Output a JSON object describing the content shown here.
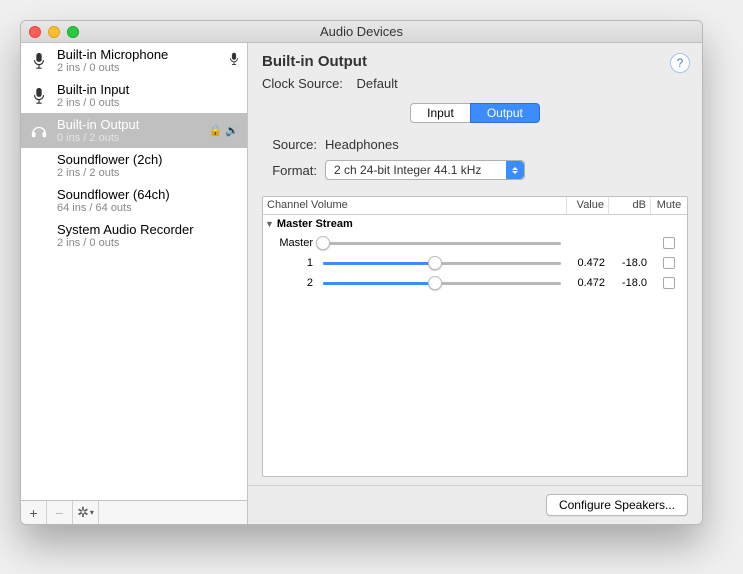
{
  "window": {
    "title": "Audio Devices"
  },
  "sidebar": {
    "devices": [
      {
        "name": "Built-in Microphone",
        "sub": "2 ins / 0 outs",
        "icon": "mic",
        "default_in": true
      },
      {
        "name": "Built-in Input",
        "sub": "2 ins / 0 outs",
        "icon": "mic"
      },
      {
        "name": "Built-in Output",
        "sub": "0 ins / 2 outs",
        "icon": "headphones",
        "selected": true,
        "default_out": true
      },
      {
        "name": "Soundflower (2ch)",
        "sub": "2 ins / 2 outs",
        "icon": "none"
      },
      {
        "name": "Soundflower (64ch)",
        "sub": "64 ins / 64 outs",
        "icon": "none"
      },
      {
        "name": "System Audio Recorder",
        "sub": "2 ins / 0 outs",
        "icon": "none"
      }
    ]
  },
  "detail": {
    "title": "Built-in Output",
    "clock_label": "Clock Source:",
    "clock_value": "Default",
    "tabs": {
      "input": "Input",
      "output": "Output",
      "active": "output"
    },
    "source_label": "Source:",
    "source_value": "Headphones",
    "format_label": "Format:",
    "format_value": "2 ch 24-bit Integer 44.1 kHz"
  },
  "table": {
    "headers": {
      "channel": "Channel Volume",
      "value": "Value",
      "db": "dB",
      "mute": "Mute"
    },
    "group": "Master Stream",
    "rows": [
      {
        "ch": "Master",
        "fill": 0,
        "value": "",
        "db": "",
        "disabled": true
      },
      {
        "ch": "1",
        "fill": 47.2,
        "value": "0.472",
        "db": "-18.0"
      },
      {
        "ch": "2",
        "fill": 47.2,
        "value": "0.472",
        "db": "-18.0"
      }
    ]
  },
  "footer": {
    "configure": "Configure Speakers..."
  }
}
